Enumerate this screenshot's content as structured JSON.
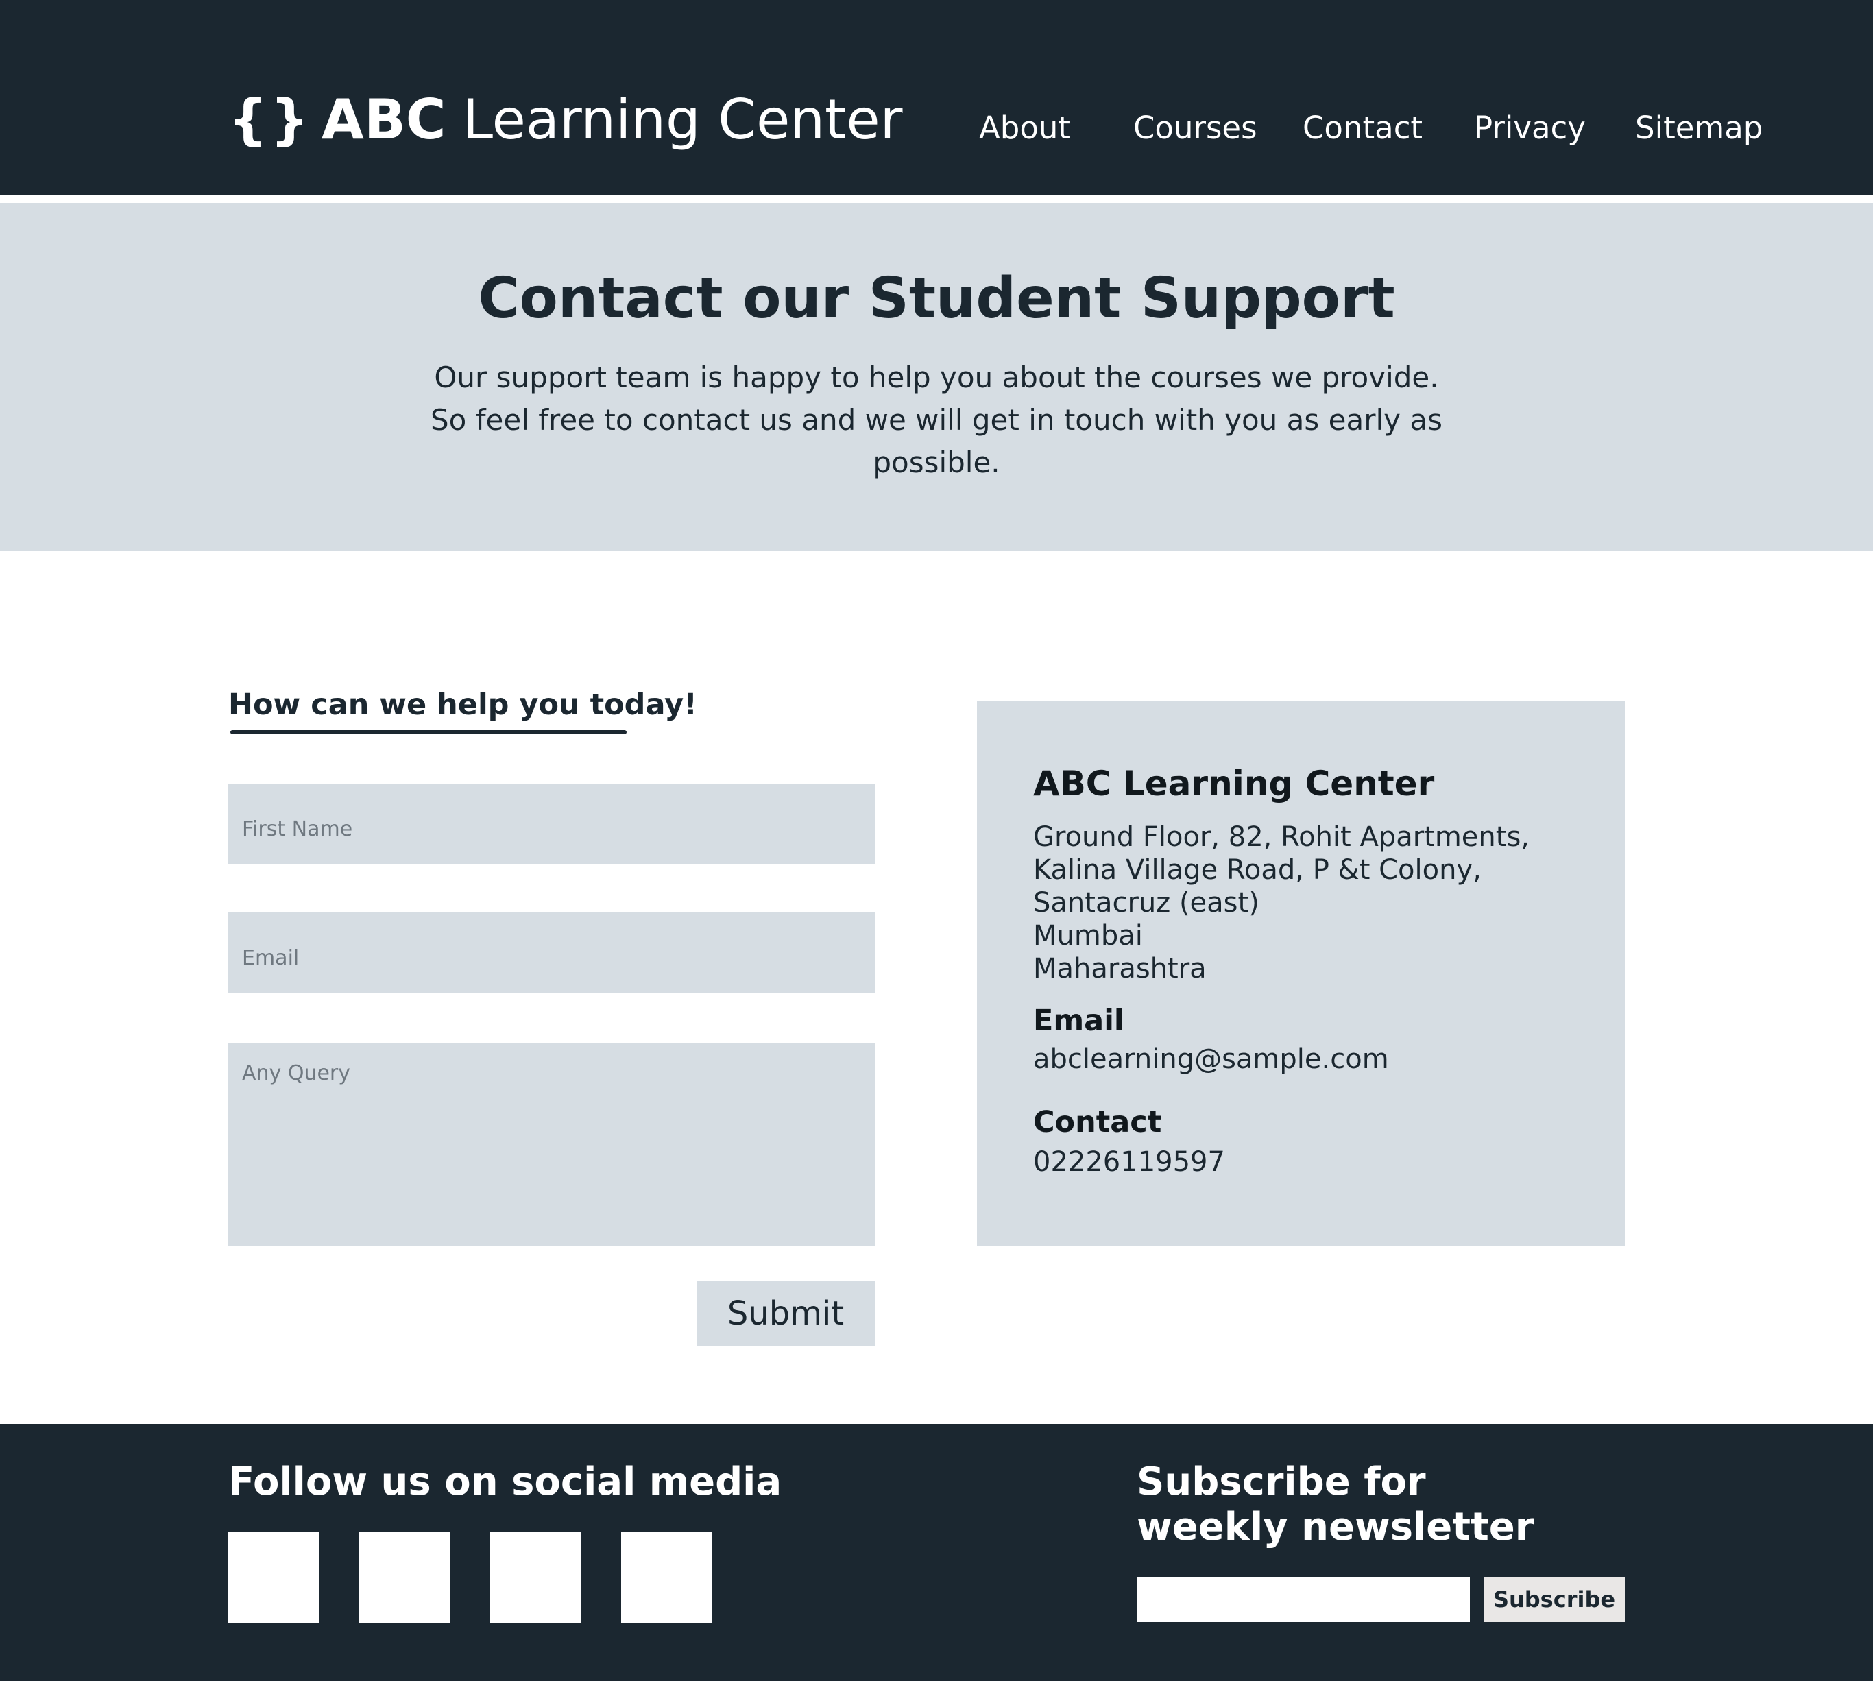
{
  "header": {
    "logo_icon": "{}",
    "logo_bold": "ABC",
    "logo_light": "Learning Center",
    "nav": [
      "About",
      "Courses",
      "Contact",
      "Privacy",
      "Sitemap"
    ]
  },
  "hero": {
    "title": "Contact our Student Support",
    "text": "Our support team is happy to help you about the courses we provide. So feel free to contact us and we will get in touch with you as early as possible."
  },
  "form": {
    "heading": "How can we help you today!",
    "first_name_placeholder": "First Name",
    "email_placeholder": "Email",
    "query_placeholder": "Any Query",
    "submit_label": "Submit"
  },
  "info": {
    "title": "ABC Learning Center",
    "address": [
      "Ground Floor, 82, Rohit Apartments,",
      "Kalina Village Road, P &t Colony,",
      "Santacruz (east)",
      "Mumbai",
      "Maharashtra"
    ],
    "email_label": "Email",
    "email": "abclearning@sample.com",
    "contact_label": "Contact",
    "phone": "02226119597"
  },
  "footer": {
    "social_title": "Follow us on social media",
    "social_icons": [
      "social-icon-1",
      "social-icon-2",
      "social-icon-3",
      "social-icon-4"
    ],
    "newsletter_title": "Subscribe for weekly newsletter",
    "newsletter_placeholder": "",
    "subscribe_label": "Subscribe"
  },
  "colors": {
    "dark": "#1b2730",
    "light_panel": "#d6dde3",
    "white": "#ffffff",
    "button_light": "#e9e7e6"
  }
}
